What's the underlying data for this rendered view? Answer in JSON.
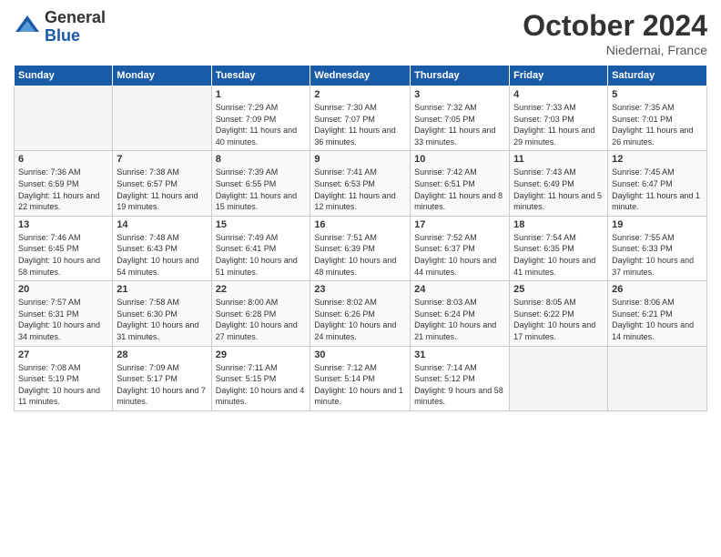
{
  "header": {
    "logo_general": "General",
    "logo_blue": "Blue",
    "month_title": "October 2024",
    "location": "Niedernai, France"
  },
  "days_of_week": [
    "Sunday",
    "Monday",
    "Tuesday",
    "Wednesday",
    "Thursday",
    "Friday",
    "Saturday"
  ],
  "weeks": [
    [
      {
        "day": "",
        "sunrise": "",
        "sunset": "",
        "daylight": ""
      },
      {
        "day": "",
        "sunrise": "",
        "sunset": "",
        "daylight": ""
      },
      {
        "day": "1",
        "sunrise": "Sunrise: 7:29 AM",
        "sunset": "Sunset: 7:09 PM",
        "daylight": "Daylight: 11 hours and 40 minutes."
      },
      {
        "day": "2",
        "sunrise": "Sunrise: 7:30 AM",
        "sunset": "Sunset: 7:07 PM",
        "daylight": "Daylight: 11 hours and 36 minutes."
      },
      {
        "day": "3",
        "sunrise": "Sunrise: 7:32 AM",
        "sunset": "Sunset: 7:05 PM",
        "daylight": "Daylight: 11 hours and 33 minutes."
      },
      {
        "day": "4",
        "sunrise": "Sunrise: 7:33 AM",
        "sunset": "Sunset: 7:03 PM",
        "daylight": "Daylight: 11 hours and 29 minutes."
      },
      {
        "day": "5",
        "sunrise": "Sunrise: 7:35 AM",
        "sunset": "Sunset: 7:01 PM",
        "daylight": "Daylight: 11 hours and 26 minutes."
      }
    ],
    [
      {
        "day": "6",
        "sunrise": "Sunrise: 7:36 AM",
        "sunset": "Sunset: 6:59 PM",
        "daylight": "Daylight: 11 hours and 22 minutes."
      },
      {
        "day": "7",
        "sunrise": "Sunrise: 7:38 AM",
        "sunset": "Sunset: 6:57 PM",
        "daylight": "Daylight: 11 hours and 19 minutes."
      },
      {
        "day": "8",
        "sunrise": "Sunrise: 7:39 AM",
        "sunset": "Sunset: 6:55 PM",
        "daylight": "Daylight: 11 hours and 15 minutes."
      },
      {
        "day": "9",
        "sunrise": "Sunrise: 7:41 AM",
        "sunset": "Sunset: 6:53 PM",
        "daylight": "Daylight: 11 hours and 12 minutes."
      },
      {
        "day": "10",
        "sunrise": "Sunrise: 7:42 AM",
        "sunset": "Sunset: 6:51 PM",
        "daylight": "Daylight: 11 hours and 8 minutes."
      },
      {
        "day": "11",
        "sunrise": "Sunrise: 7:43 AM",
        "sunset": "Sunset: 6:49 PM",
        "daylight": "Daylight: 11 hours and 5 minutes."
      },
      {
        "day": "12",
        "sunrise": "Sunrise: 7:45 AM",
        "sunset": "Sunset: 6:47 PM",
        "daylight": "Daylight: 11 hours and 1 minute."
      }
    ],
    [
      {
        "day": "13",
        "sunrise": "Sunrise: 7:46 AM",
        "sunset": "Sunset: 6:45 PM",
        "daylight": "Daylight: 10 hours and 58 minutes."
      },
      {
        "day": "14",
        "sunrise": "Sunrise: 7:48 AM",
        "sunset": "Sunset: 6:43 PM",
        "daylight": "Daylight: 10 hours and 54 minutes."
      },
      {
        "day": "15",
        "sunrise": "Sunrise: 7:49 AM",
        "sunset": "Sunset: 6:41 PM",
        "daylight": "Daylight: 10 hours and 51 minutes."
      },
      {
        "day": "16",
        "sunrise": "Sunrise: 7:51 AM",
        "sunset": "Sunset: 6:39 PM",
        "daylight": "Daylight: 10 hours and 48 minutes."
      },
      {
        "day": "17",
        "sunrise": "Sunrise: 7:52 AM",
        "sunset": "Sunset: 6:37 PM",
        "daylight": "Daylight: 10 hours and 44 minutes."
      },
      {
        "day": "18",
        "sunrise": "Sunrise: 7:54 AM",
        "sunset": "Sunset: 6:35 PM",
        "daylight": "Daylight: 10 hours and 41 minutes."
      },
      {
        "day": "19",
        "sunrise": "Sunrise: 7:55 AM",
        "sunset": "Sunset: 6:33 PM",
        "daylight": "Daylight: 10 hours and 37 minutes."
      }
    ],
    [
      {
        "day": "20",
        "sunrise": "Sunrise: 7:57 AM",
        "sunset": "Sunset: 6:31 PM",
        "daylight": "Daylight: 10 hours and 34 minutes."
      },
      {
        "day": "21",
        "sunrise": "Sunrise: 7:58 AM",
        "sunset": "Sunset: 6:30 PM",
        "daylight": "Daylight: 10 hours and 31 minutes."
      },
      {
        "day": "22",
        "sunrise": "Sunrise: 8:00 AM",
        "sunset": "Sunset: 6:28 PM",
        "daylight": "Daylight: 10 hours and 27 minutes."
      },
      {
        "day": "23",
        "sunrise": "Sunrise: 8:02 AM",
        "sunset": "Sunset: 6:26 PM",
        "daylight": "Daylight: 10 hours and 24 minutes."
      },
      {
        "day": "24",
        "sunrise": "Sunrise: 8:03 AM",
        "sunset": "Sunset: 6:24 PM",
        "daylight": "Daylight: 10 hours and 21 minutes."
      },
      {
        "day": "25",
        "sunrise": "Sunrise: 8:05 AM",
        "sunset": "Sunset: 6:22 PM",
        "daylight": "Daylight: 10 hours and 17 minutes."
      },
      {
        "day": "26",
        "sunrise": "Sunrise: 8:06 AM",
        "sunset": "Sunset: 6:21 PM",
        "daylight": "Daylight: 10 hours and 14 minutes."
      }
    ],
    [
      {
        "day": "27",
        "sunrise": "Sunrise: 7:08 AM",
        "sunset": "Sunset: 5:19 PM",
        "daylight": "Daylight: 10 hours and 11 minutes."
      },
      {
        "day": "28",
        "sunrise": "Sunrise: 7:09 AM",
        "sunset": "Sunset: 5:17 PM",
        "daylight": "Daylight: 10 hours and 7 minutes."
      },
      {
        "day": "29",
        "sunrise": "Sunrise: 7:11 AM",
        "sunset": "Sunset: 5:15 PM",
        "daylight": "Daylight: 10 hours and 4 minutes."
      },
      {
        "day": "30",
        "sunrise": "Sunrise: 7:12 AM",
        "sunset": "Sunset: 5:14 PM",
        "daylight": "Daylight: 10 hours and 1 minute."
      },
      {
        "day": "31",
        "sunrise": "Sunrise: 7:14 AM",
        "sunset": "Sunset: 5:12 PM",
        "daylight": "Daylight: 9 hours and 58 minutes."
      },
      {
        "day": "",
        "sunrise": "",
        "sunset": "",
        "daylight": ""
      },
      {
        "day": "",
        "sunrise": "",
        "sunset": "",
        "daylight": ""
      }
    ]
  ]
}
